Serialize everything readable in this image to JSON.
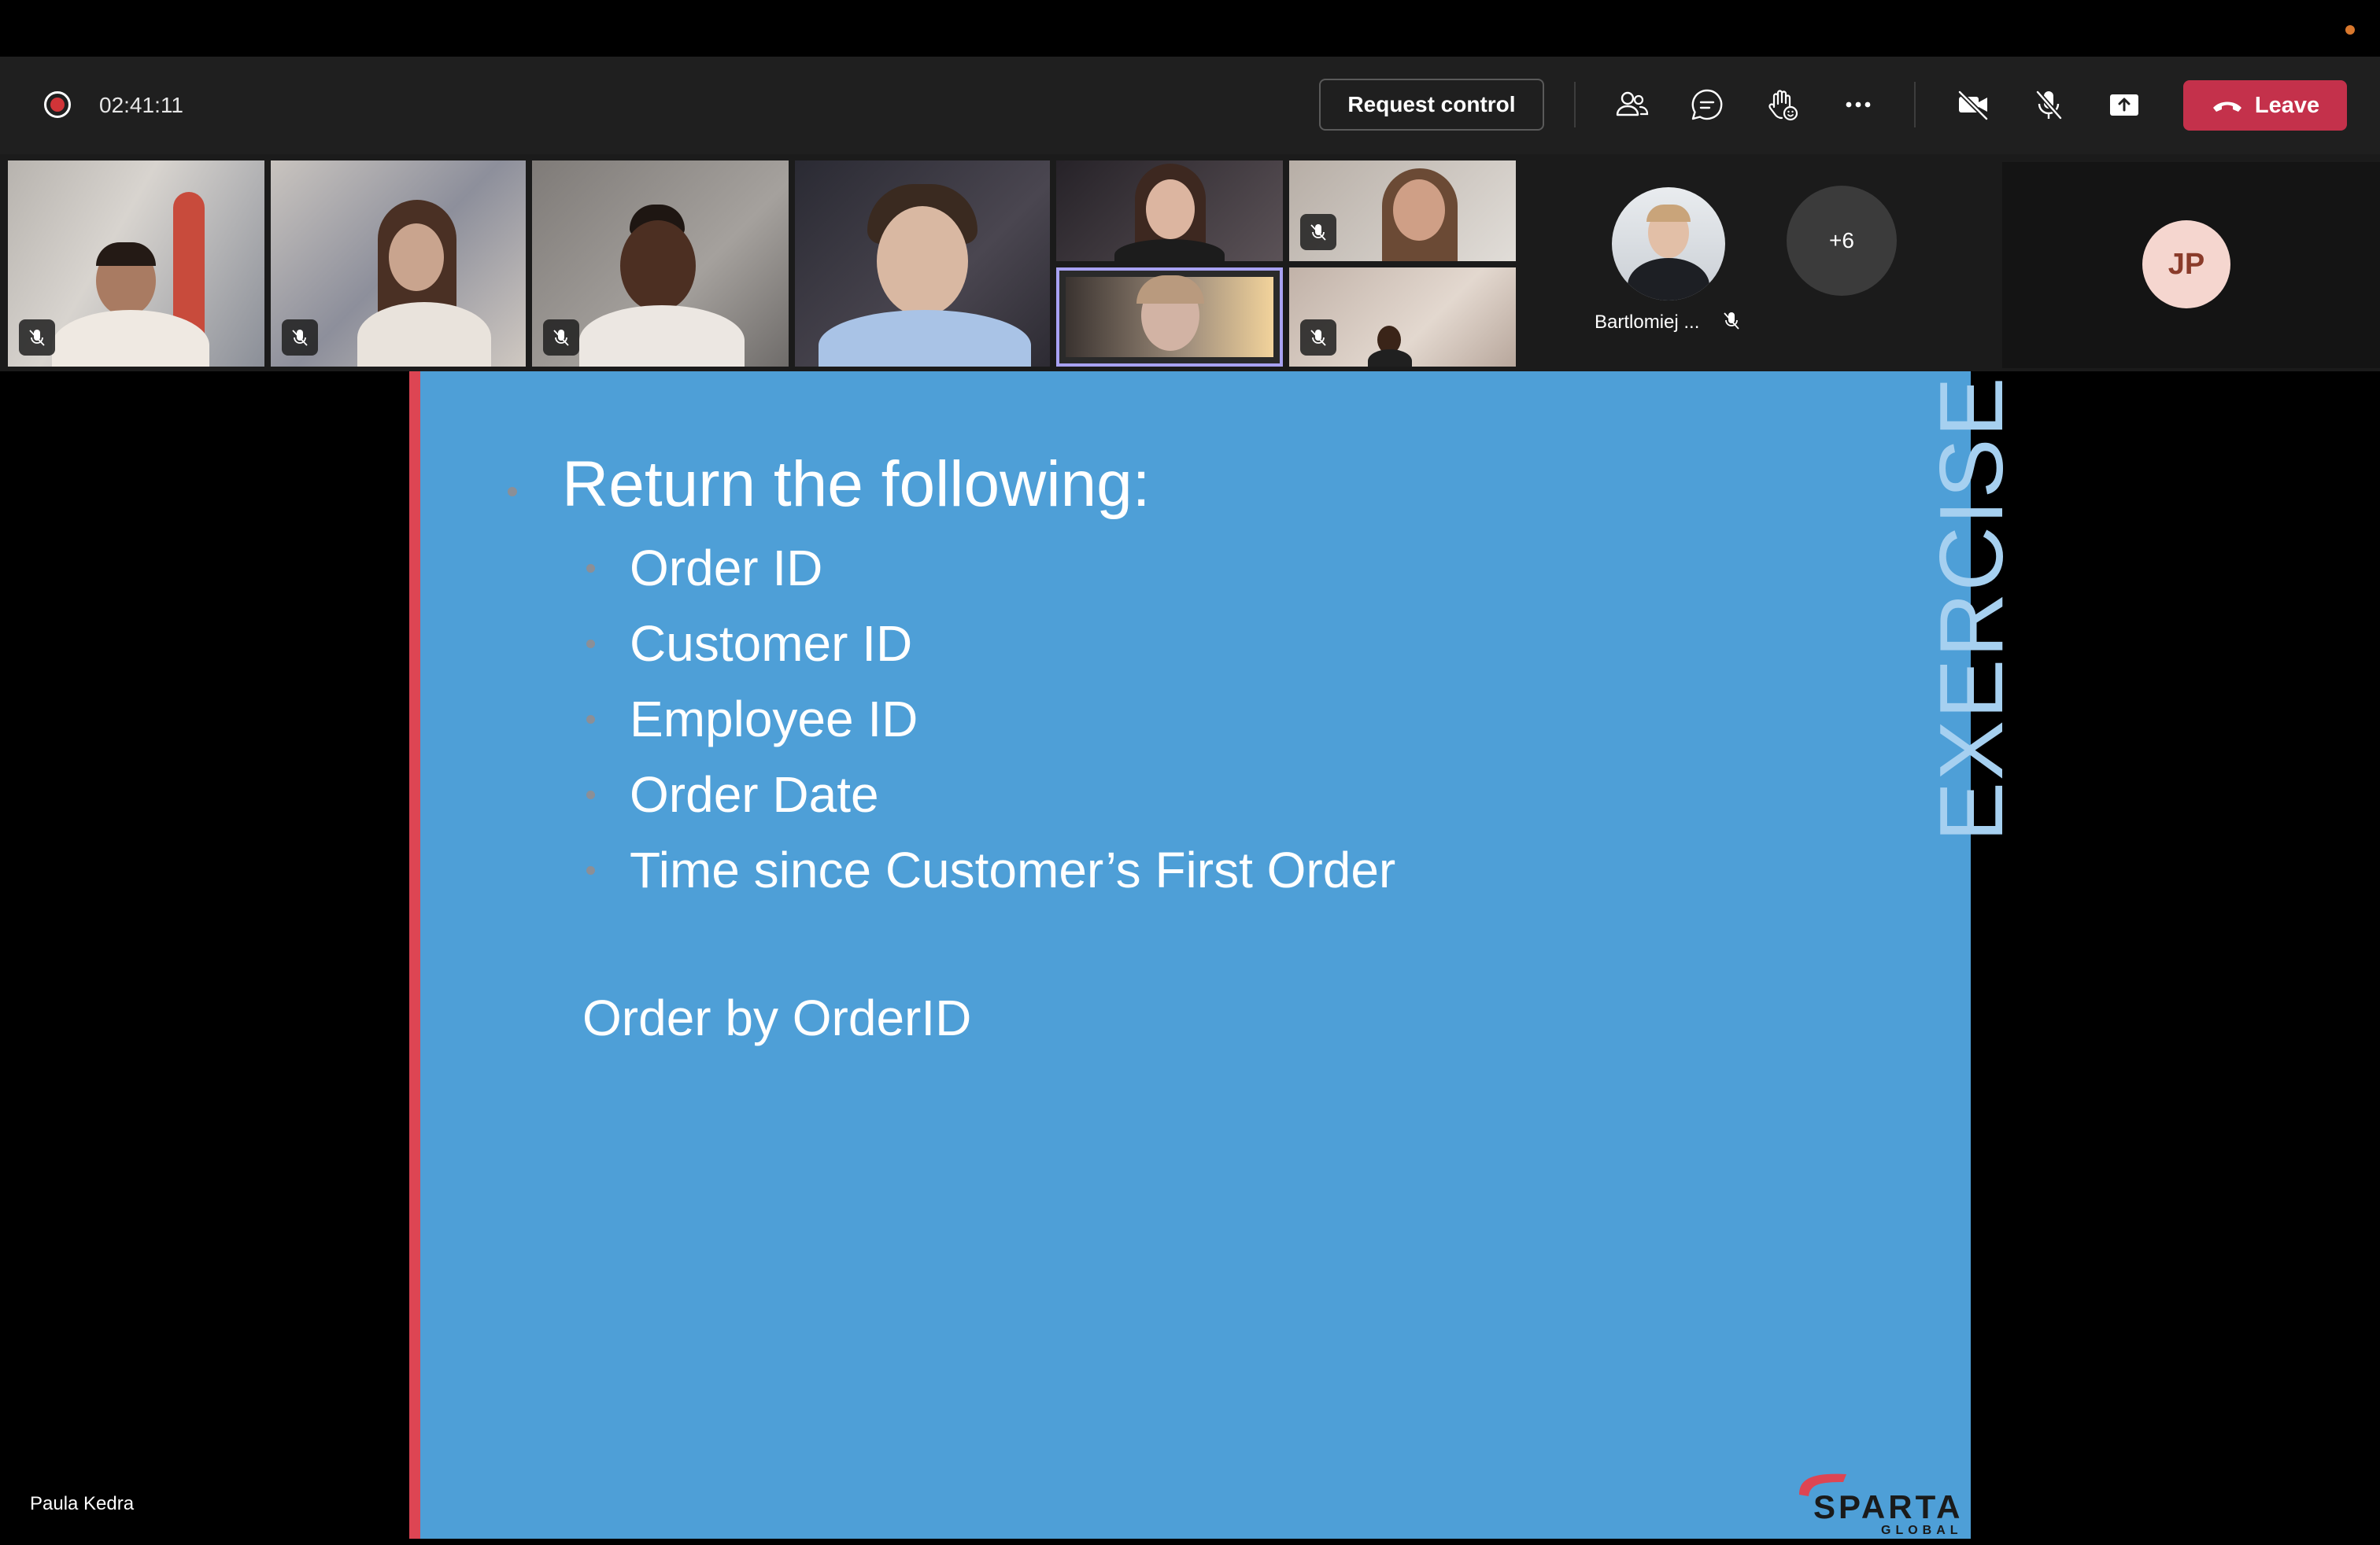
{
  "toolbar": {
    "recording_time": "02:41:11",
    "request_control_label": "Request control",
    "leave_label": "Leave",
    "icons": [
      "participants-icon",
      "chat-icon",
      "raise-hand-icon",
      "more-options-icon",
      "camera-off-icon",
      "mic-off-icon",
      "share-screen-icon"
    ]
  },
  "gallery": {
    "participants": [
      {
        "name": "",
        "muted": true
      },
      {
        "name": "",
        "muted": true
      },
      {
        "name": "",
        "muted": true
      },
      {
        "name": "",
        "muted": false
      },
      {
        "name": "",
        "muted": false
      },
      {
        "name": "",
        "muted": true
      },
      {
        "name": "",
        "muted": false
      },
      {
        "name": "",
        "muted": true
      }
    ],
    "avatar_participant": {
      "name": "Bartlomiej ...",
      "muted": true
    },
    "overflow_count": "+6",
    "self_initials": "JP"
  },
  "slide": {
    "heading": "Return the following:",
    "items": [
      "Order ID",
      "Customer ID",
      "Employee ID",
      "Order Date",
      "Time since Customer’s First Order"
    ],
    "footer_instruction": "Order by OrderID",
    "side_label": "EXERCISE",
    "logo_text": "SPARTA",
    "logo_subtext": "GLOBAL"
  },
  "presenter": {
    "name": "Paula Kedra"
  },
  "colors": {
    "toolbar_bg": "#1f1f1f",
    "leave_red": "#c4314b",
    "slide_blue": "#4e9fd7",
    "slide_accent_red": "#dd4553",
    "active_speaker_border": "#a8a2f2"
  }
}
